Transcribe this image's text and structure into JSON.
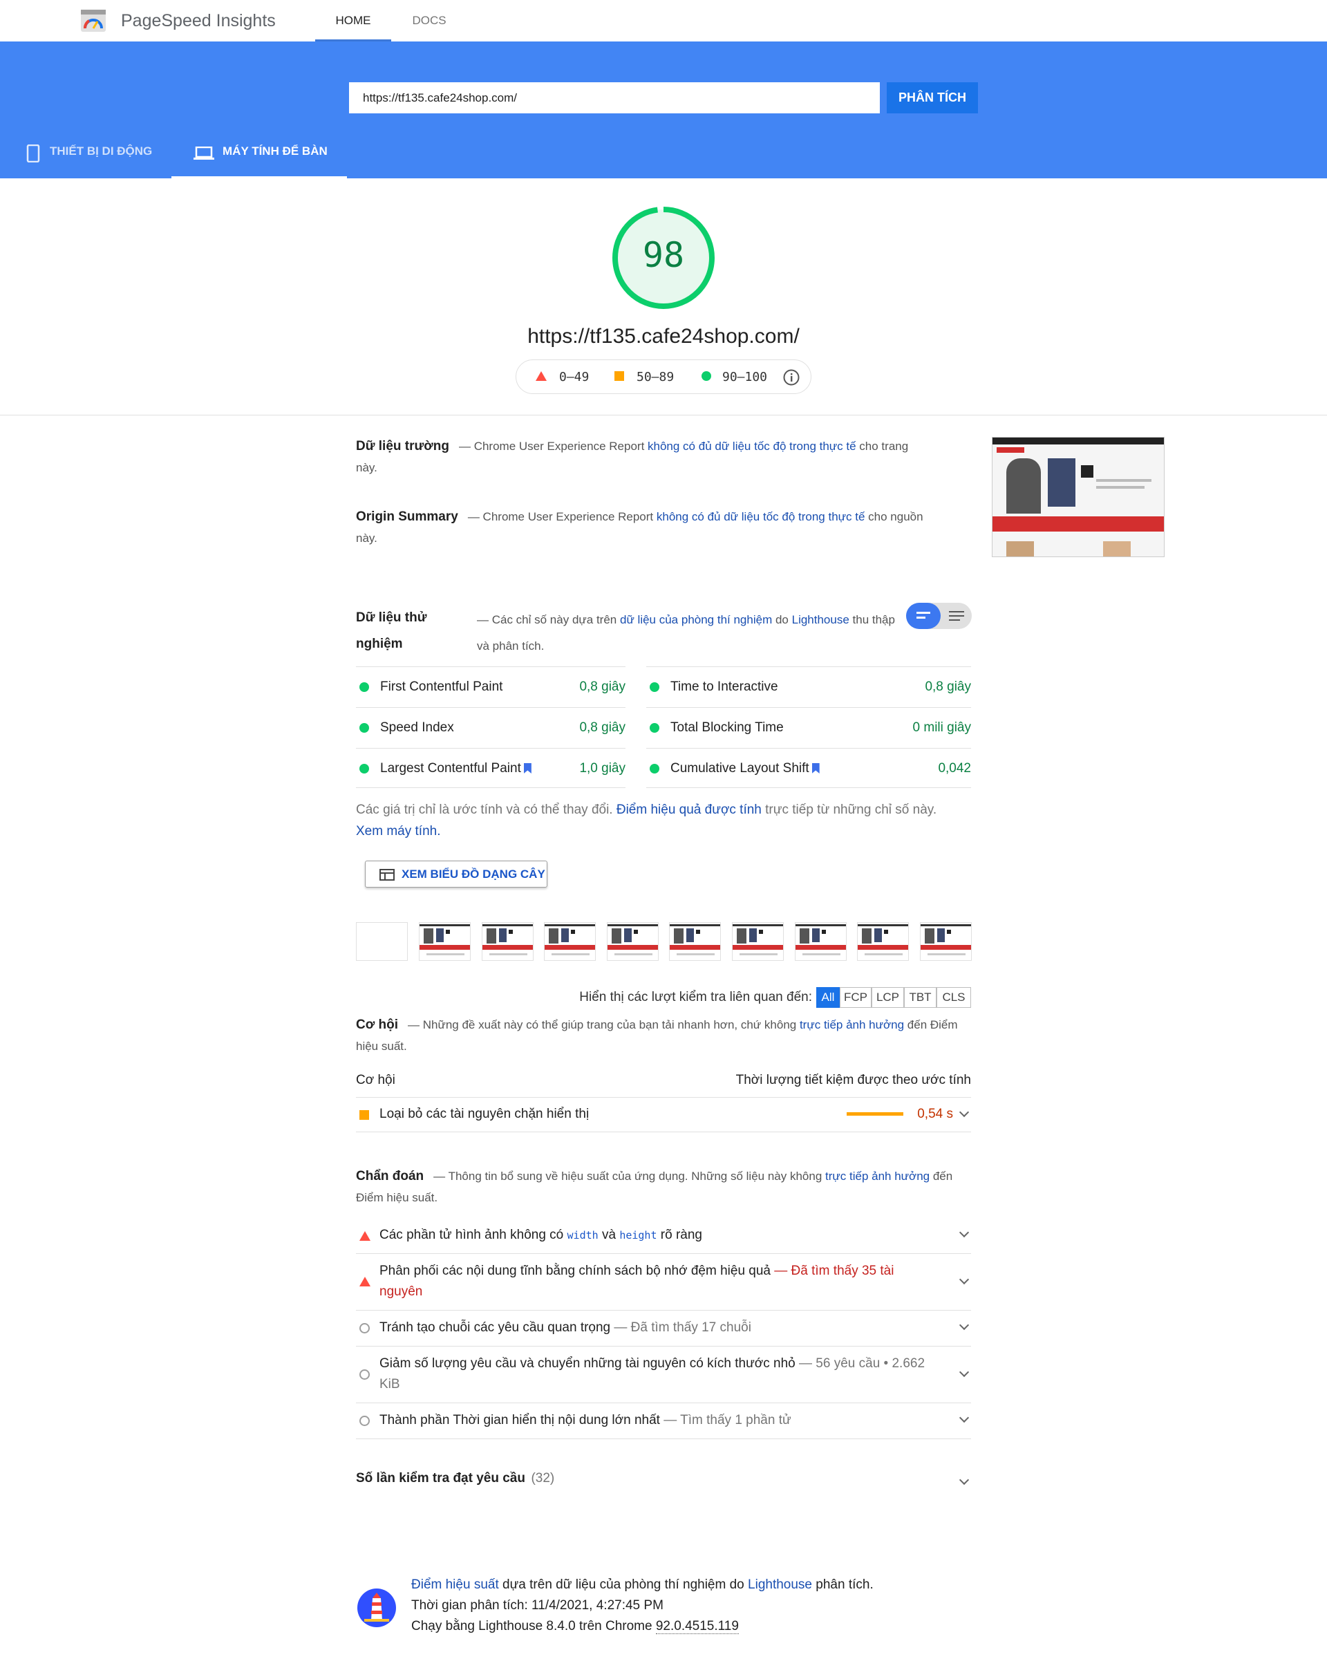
{
  "app": {
    "brand": "PageSpeed Insights",
    "tabs": [
      "HOME",
      "DOCS"
    ]
  },
  "search": {
    "url": "https://tf135.cafe24shop.com/",
    "analyze_label": "PHÂN TÍCH"
  },
  "device_tabs": {
    "mobile": "THIẾT BỊ DI ĐỘNG",
    "desktop": "MÁY TÍNH ĐỂ BÀN"
  },
  "score": {
    "value": "98",
    "fraction": 0.98,
    "url": "https://tf135.cafe24shop.com/",
    "legend": [
      "0–49",
      "50–89",
      "90–100"
    ]
  },
  "colors": {
    "header": "#4285f4",
    "pass": "#0cce6b",
    "average": "#ffa400",
    "fail": "#ff4e42"
  },
  "field": {
    "title": "Dữ liệu trường",
    "text_before": "— Chrome User Experience Report ",
    "link": "không có đủ dữ liệu tốc độ trong thực tế",
    "text_after": " cho trang này."
  },
  "origin": {
    "title": "Origin Summary",
    "text_before": "— Chrome User Experience Report ",
    "link": "không có đủ dữ liệu tốc độ trong thực tế",
    "text_after": " cho nguồn này."
  },
  "lab": {
    "title": "Dữ liệu thử nghiệm",
    "text_before": "— Các chỉ số này dựa trên ",
    "link1": "dữ liệu của phòng thí nghiệm",
    "text_mid": " do ",
    "link2": "Lighthouse",
    "text_after": " thu thập và phân tích."
  },
  "metrics": [
    {
      "label": "First Contentful Paint",
      "value": "0,8 giây"
    },
    {
      "label": "Time to Interactive",
      "value": "0,8 giây"
    },
    {
      "label": "Speed Index",
      "value": "0,8 giây"
    },
    {
      "label": "Total Blocking Time",
      "value": "0 mili giây"
    },
    {
      "label": "Largest Contentful Paint",
      "value": "1,0 giây"
    },
    {
      "label": "Cumulative Layout Shift",
      "value": "0,042"
    }
  ],
  "note": {
    "text1": "Các giá trị chỉ là ước tính và có thể thay đổi. ",
    "link1": "Điểm hiệu quả được tính",
    "text2": " trực tiếp từ những chỉ số này. ",
    "link2": "Xem máy tính."
  },
  "treemap_label": "XEM BIỂU ĐỒ DẠNG CÂY",
  "filter": {
    "label": "Hiển thị các lượt kiểm tra liên quan đến:",
    "options": [
      "All",
      "FCP",
      "LCP",
      "TBT",
      "CLS"
    ]
  },
  "opportunities": {
    "title": "Cơ hội",
    "text_before": "— Những đề xuất này có thể giúp trang của bạn tải nhanh hơn, chứ không ",
    "link": "trực tiếp ảnh hưởng",
    "text_after": " đến Điểm hiệu suất.",
    "col_left": "Cơ hội",
    "col_right": "Thời lượng tiết kiệm được theo ước tính",
    "items": [
      {
        "label": "Loại bỏ các tài nguyên chặn hiển thị",
        "value": "0,54 s"
      }
    ]
  },
  "diagnostics": {
    "title": "Chẩn đoán",
    "text_before": "— Thông tin bổ sung về hiệu suất của ứng dụng. Những số liệu này không ",
    "link": "trực tiếp ảnh hưởng",
    "text_after": " đến Điểm hiệu suất.",
    "items": [
      {
        "a": "Các phần tử hình ảnh không có ",
        "code1": "width",
        "b": " và ",
        "code2": "height",
        "c": " rõ ràng"
      },
      {
        "label": "Phân phối các nội dung tĩnh bằng chính sách bộ nhớ đệm hiệu quả ",
        "detail": "— Đã tìm thấy 35 tài nguyên"
      },
      {
        "label": "Tránh tạo chuỗi các yêu cầu quan trọng ",
        "detail": "— Đã tìm thấy 17 chuỗi"
      },
      {
        "label": "Giảm số lượng yêu cầu và chuyển những tài nguyên có kích thước nhỏ ",
        "detail": "— 56 yêu cầu • 2.662 KiB"
      },
      {
        "label": "Thành phần Thời gian hiển thị nội dung lớn nhất ",
        "detail": "— Tìm thấy 1 phần tử"
      }
    ]
  },
  "passed": {
    "label": "Số lần kiểm tra đạt yêu cầu",
    "count": "(32)"
  },
  "footer": {
    "link1": "Điểm hiệu suất",
    "text1": " dựa trên dữ liệu của phòng thí nghiệm do ",
    "link2": "Lighthouse",
    "text2": " phân tích.",
    "time": "Thời gian phân tích: 11/4/2021, 4:27:45 PM",
    "runner": "Chạy bằng Lighthouse 8.4.0 trên Chrome ",
    "version": "92.0.4515.119"
  }
}
